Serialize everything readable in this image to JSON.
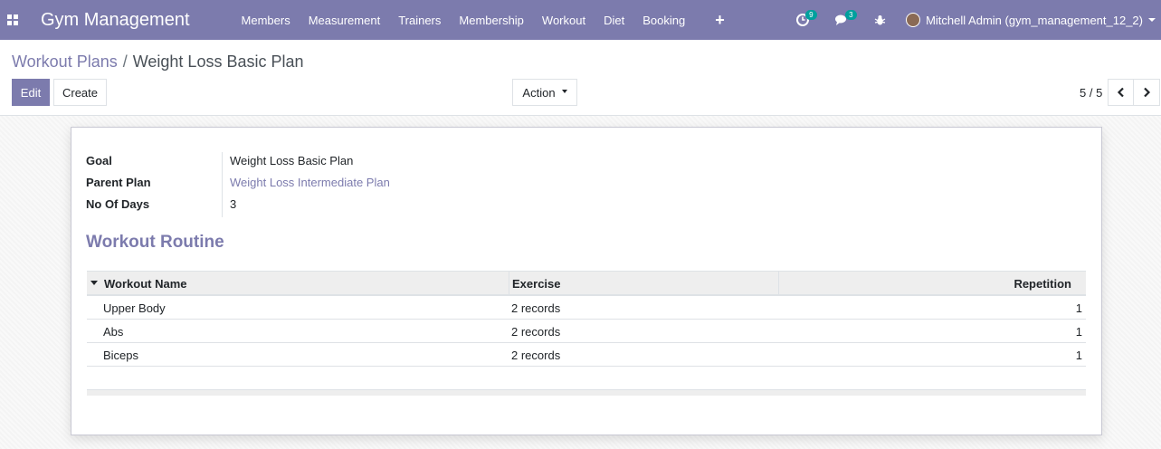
{
  "navbar": {
    "brand": "Gym Management",
    "menu": [
      "Members",
      "Measurement",
      "Trainers",
      "Membership",
      "Workout",
      "Diet",
      "Booking"
    ],
    "plus": "+",
    "activity_badge": "9",
    "messages_badge": "3",
    "user_name": "Mitchell Admin (gym_management_12_2)",
    "accent_color": "#7c7bad"
  },
  "breadcrumb": {
    "parent": "Workout Plans",
    "separator": "/",
    "current": "Weight Loss Basic Plan"
  },
  "buttons": {
    "edit": "Edit",
    "create": "Create",
    "action": "Action"
  },
  "pager": {
    "value": "5 / 5"
  },
  "form": {
    "fields": [
      {
        "label": "Goal",
        "value": "Weight Loss Basic Plan"
      },
      {
        "label": "Parent Plan",
        "value": "Weight Loss Intermediate Plan"
      },
      {
        "label": "No Of Days",
        "value": "3"
      }
    ],
    "section_title": "Workout Routine",
    "table": {
      "columns": [
        "Workout Name",
        "Exercise",
        "Repetition"
      ],
      "rows": [
        {
          "name": "Upper Body",
          "exercise": "2 records",
          "repetition": "1"
        },
        {
          "name": "Abs",
          "exercise": "2 records",
          "repetition": "1"
        },
        {
          "name": "Biceps",
          "exercise": "2 records",
          "repetition": "1"
        }
      ]
    }
  }
}
